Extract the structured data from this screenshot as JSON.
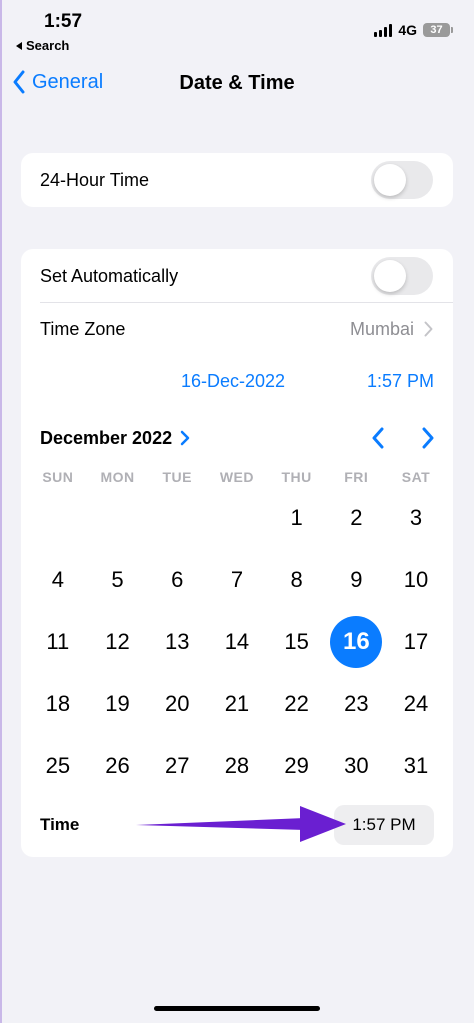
{
  "status_bar": {
    "time": "1:57",
    "back_app": "Search",
    "network": "4G",
    "battery": "37"
  },
  "nav": {
    "back_label": "General",
    "title": "Date & Time"
  },
  "hour24": {
    "label": "24-Hour Time",
    "on": false
  },
  "settings": {
    "set_auto_label": "Set Automatically",
    "set_auto_on": false,
    "time_zone_label": "Time Zone",
    "time_zone_value": "Mumbai",
    "date_display": "16-Dec-2022",
    "time_display": "1:57 PM"
  },
  "calendar": {
    "month_label": "December 2022",
    "weekdays": [
      "SUN",
      "MON",
      "TUE",
      "WED",
      "THU",
      "FRI",
      "SAT"
    ],
    "first_weekday_index": 4,
    "days_in_month": 31,
    "selected_day": 16
  },
  "time_row": {
    "label": "Time",
    "value": "1:57 PM"
  },
  "annotation": {
    "arrow_color": "#6a1fd1"
  },
  "colors": {
    "accent": "#0a7cff",
    "background": "#f2f2f7"
  }
}
